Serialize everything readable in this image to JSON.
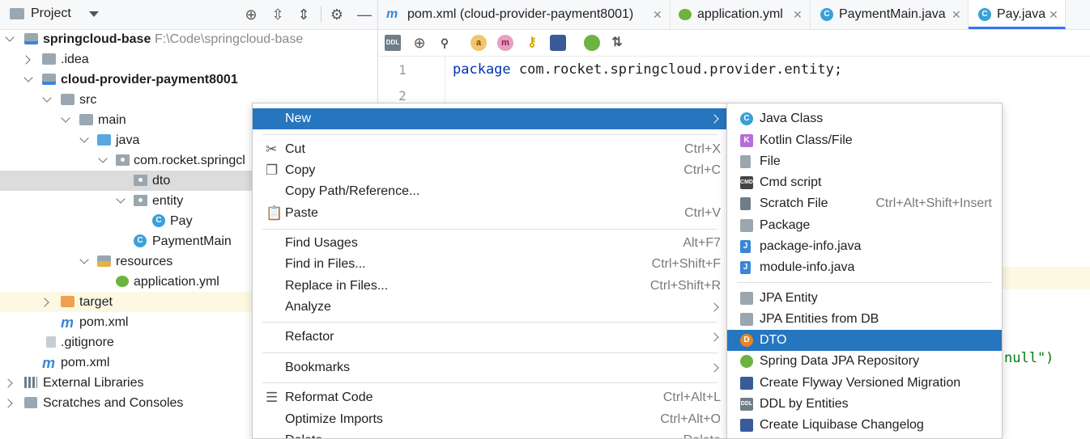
{
  "project_panel": {
    "title": "Project",
    "tree": [
      {
        "label": "springcloud-base",
        "path": "F:\\Code\\springcloud-base"
      },
      {
        "label": ".idea"
      },
      {
        "label": "cloud-provider-payment8001"
      },
      {
        "label": "src"
      },
      {
        "label": "main"
      },
      {
        "label": "java"
      },
      {
        "label": "com.rocket.springcl"
      },
      {
        "label": "dto"
      },
      {
        "label": "entity"
      },
      {
        "label": "Pay"
      },
      {
        "label": "PaymentMain"
      },
      {
        "label": "resources"
      },
      {
        "label": "application.yml"
      },
      {
        "label": "target"
      },
      {
        "label": "pom.xml"
      },
      {
        "label": ".gitignore"
      },
      {
        "label": "pom.xml"
      },
      {
        "label": "External Libraries"
      },
      {
        "label": "Scratches and Consoles"
      }
    ]
  },
  "tabs": [
    {
      "label": "pom.xml (cloud-provider-payment8001)"
    },
    {
      "label": "application.yml"
    },
    {
      "label": "PaymentMain.java"
    },
    {
      "label": "Pay.java"
    }
  ],
  "toolbar": {
    "ddl": "DDL",
    "a": "a",
    "m": "m"
  },
  "editor": {
    "lines": [
      "1",
      "2"
    ],
    "line1_kw": "package",
    "line1_rest": " com.rocket.springcloud.provider.entity;",
    "fragment": "null\")"
  },
  "context_menu": {
    "items": [
      {
        "label": "New",
        "shortcut": ""
      },
      {
        "label": "Cut",
        "shortcut": "Ctrl+X"
      },
      {
        "label": "Copy",
        "shortcut": "Ctrl+C"
      },
      {
        "label": "Copy Path/Reference...",
        "shortcut": ""
      },
      {
        "label": "Paste",
        "shortcut": "Ctrl+V"
      },
      {
        "label": "Find Usages",
        "shortcut": "Alt+F7"
      },
      {
        "label": "Find in Files...",
        "shortcut": "Ctrl+Shift+F"
      },
      {
        "label": "Replace in Files...",
        "shortcut": "Ctrl+Shift+R"
      },
      {
        "label": "Analyze",
        "shortcut": ""
      },
      {
        "label": "Refactor",
        "shortcut": ""
      },
      {
        "label": "Bookmarks",
        "shortcut": ""
      },
      {
        "label": "Reformat Code",
        "shortcut": "Ctrl+Alt+L"
      },
      {
        "label": "Optimize Imports",
        "shortcut": "Ctrl+Alt+O"
      },
      {
        "label": "Delete...",
        "shortcut": "Delete"
      }
    ]
  },
  "submenu": {
    "items": [
      {
        "label": "Java Class",
        "shortcut": "",
        "icon": "C"
      },
      {
        "label": "Kotlin Class/File",
        "shortcut": "",
        "icon": "K"
      },
      {
        "label": "File",
        "shortcut": "",
        "icon": ""
      },
      {
        "label": "Cmd script",
        "shortcut": "",
        "icon": "CMD"
      },
      {
        "label": "Scratch File",
        "shortcut": "Ctrl+Alt+Shift+Insert",
        "icon": ""
      },
      {
        "label": "Package",
        "shortcut": "",
        "icon": ""
      },
      {
        "label": "package-info.java",
        "shortcut": "",
        "icon": "J"
      },
      {
        "label": "module-info.java",
        "shortcut": "",
        "icon": "J"
      },
      {
        "label": "JPA Entity",
        "shortcut": "",
        "icon": ""
      },
      {
        "label": "JPA Entities from DB",
        "shortcut": "",
        "icon": ""
      },
      {
        "label": "DTO",
        "shortcut": "",
        "icon": "D"
      },
      {
        "label": "Spring Data JPA Repository",
        "shortcut": "",
        "icon": ""
      },
      {
        "label": "Create Flyway Versioned Migration",
        "shortcut": "",
        "icon": ""
      },
      {
        "label": "DDL by Entities",
        "shortcut": "",
        "icon": "DDL"
      },
      {
        "label": "Create Liquibase Changelog",
        "shortcut": "",
        "icon": ""
      }
    ]
  },
  "colors": {
    "accent": "#2675bf",
    "selection": "#dcdcdc",
    "keyword": "#0033b3"
  }
}
